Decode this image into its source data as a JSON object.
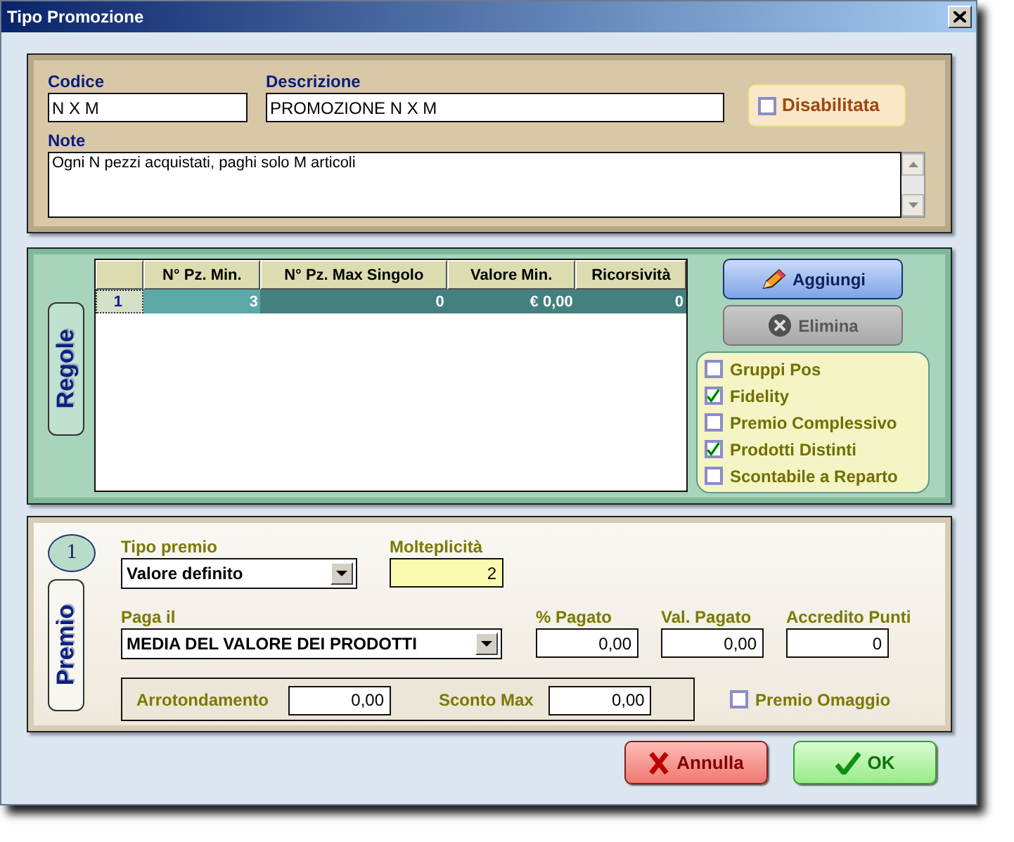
{
  "window": {
    "title": "Tipo Promozione"
  },
  "header": {
    "codice": {
      "label": "Codice",
      "value": "N X M"
    },
    "descrizione": {
      "label": "Descrizione",
      "value": "PROMOZIONE N X M"
    },
    "disabilitata": {
      "label": "Disabilitata",
      "checked": false
    },
    "note": {
      "label": "Note",
      "value": "Ogni N pezzi acquistati, paghi solo M articoli"
    }
  },
  "regole": {
    "tab_label": "Regole",
    "columns": [
      "N° Pz. Min.",
      "N° Pz. Max Singolo",
      "Valore Min.",
      "Ricorsività"
    ],
    "rows": [
      {
        "index": "1",
        "cells": [
          "3",
          "0",
          "€ 0,00",
          "0"
        ],
        "selected": true
      }
    ],
    "buttons": [
      {
        "label": "Aggiungi",
        "kind": "add",
        "disabled": false
      },
      {
        "label": "Elimina",
        "kind": "delete",
        "disabled": true
      }
    ],
    "options": [
      {
        "label": "Gruppi Pos",
        "checked": false
      },
      {
        "label": "Fidelity",
        "checked": true
      },
      {
        "label": "Premio Complessivo",
        "checked": false
      },
      {
        "label": "Prodotti Distinti",
        "checked": true
      },
      {
        "label": "Scontabile a Reparto",
        "checked": false
      }
    ]
  },
  "premio": {
    "badge": "1",
    "tab_label": "Premio",
    "tipo_premio": {
      "label": "Tipo premio",
      "value": "Valore definito"
    },
    "molteplicita": {
      "label": "Molteplicità",
      "value": "2"
    },
    "paga_il": {
      "label": "Paga il",
      "value": "MEDIA DEL VALORE DEI PRODOTTI"
    },
    "fields": [
      {
        "label": "% Pagato",
        "value": "0,00"
      },
      {
        "label": "Val. Pagato",
        "value": "0,00"
      },
      {
        "label": "Accredito Punti",
        "value": "0"
      }
    ],
    "arrotondamento": {
      "label": "Arrotondamento",
      "value": "0,00"
    },
    "sconto_max": {
      "label": "Sconto Max",
      "value": "0,00"
    },
    "premio_omaggio": {
      "label": "Premio Omaggio",
      "checked": false
    }
  },
  "footer": [
    {
      "label": "Annulla",
      "kind": "cancel"
    },
    {
      "label": "OK",
      "kind": "ok"
    }
  ]
}
